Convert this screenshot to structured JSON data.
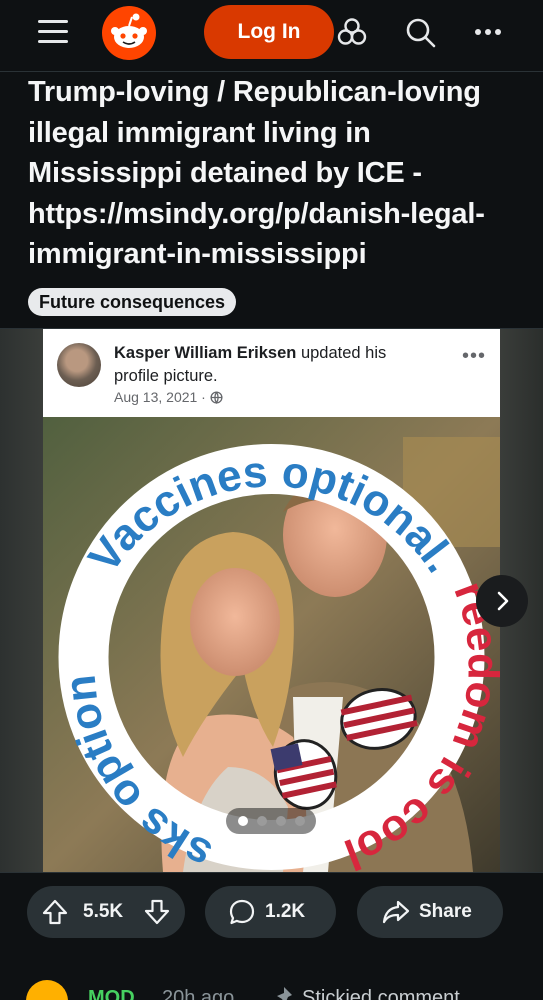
{
  "header": {
    "login_label": "Log In",
    "brand_color": "#ff4500",
    "login_color": "#d93900",
    "icons": [
      "menu-icon",
      "reddit-logo",
      "communities-icon",
      "search-icon",
      "more-icon"
    ]
  },
  "post": {
    "title": "Trump-loving / Republican-loving illegal immigrant living in Mississippi detained by ICE - https://msindy.org/p/danish-legal-immigrant-in-mississippi",
    "flair": "Future consequences"
  },
  "embedded_post": {
    "author": "Kasper William Eriksen",
    "action": "updated his profile picture.",
    "date": "Aug 13, 2021 · ",
    "frame_text_top": "Vaccines optional.",
    "frame_text_right": "Freedom is cool.",
    "frame_text_left": "Masks optional."
  },
  "carousel": {
    "page": 1,
    "total": 4
  },
  "actions": {
    "upvotes": "5.5K",
    "comments": "1.2K",
    "share_label": "Share"
  },
  "comment_peek": {
    "user": "MOD",
    "time": "20h ago",
    "badge": "Stickied comment"
  }
}
